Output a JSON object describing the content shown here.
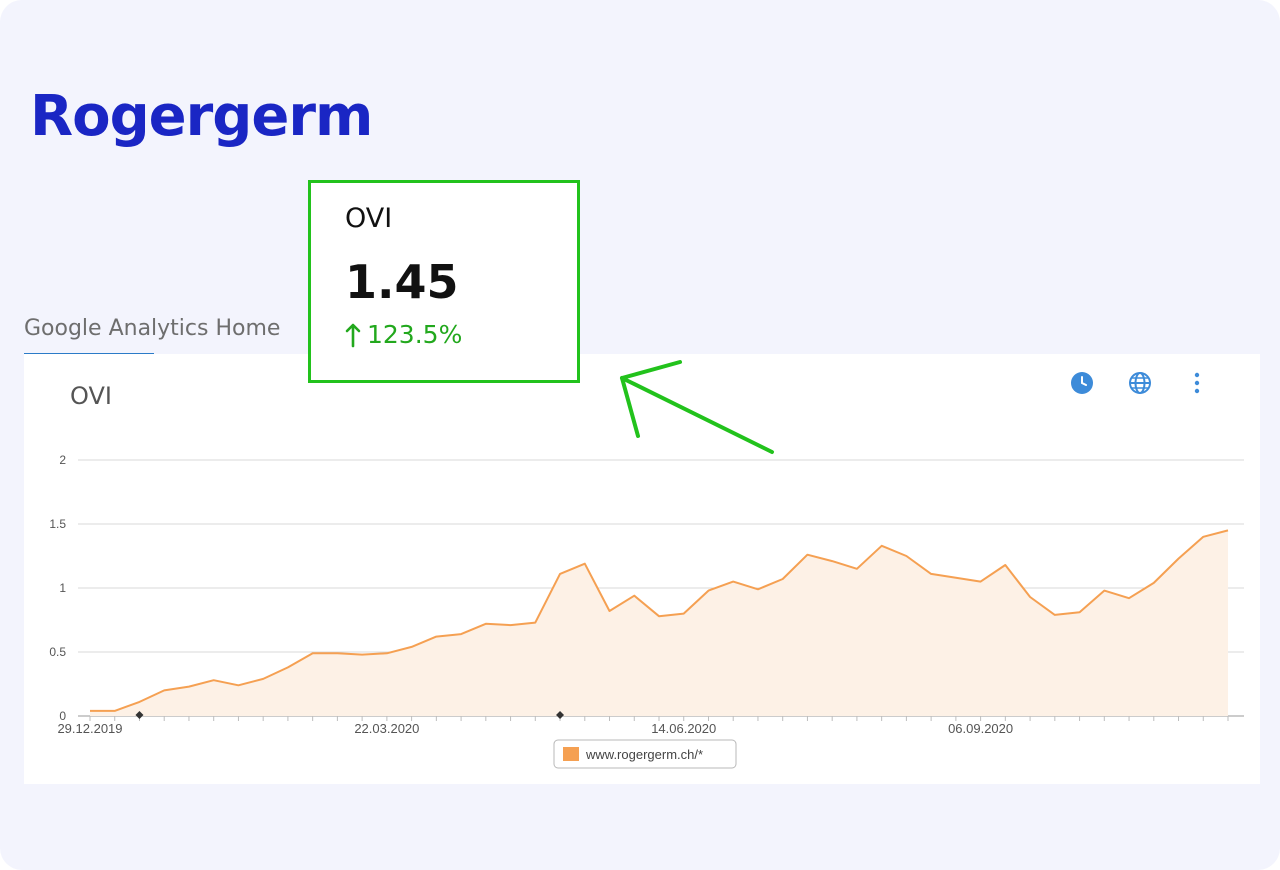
{
  "brand": {
    "title": "Rogergerm"
  },
  "tab": {
    "label": "Google Analytics Home"
  },
  "panel": {
    "title": "OVI",
    "icons": [
      "clock-icon",
      "globe-icon",
      "more-vertical-icon"
    ]
  },
  "kpi": {
    "label": "OVI",
    "value": "1.45",
    "change": "123.5%",
    "direction": "up"
  },
  "colors": {
    "brand": "#1a26c4",
    "series": "#f5a052",
    "area_fill": "#fdf1e6",
    "highlight": "#22c21c",
    "panel_icons": "#3d8bd9"
  },
  "chart_data": {
    "type": "area",
    "ylim": [
      0,
      2
    ],
    "yticks": [
      "0",
      "0.5",
      "1",
      "1.5",
      "2"
    ],
    "xtick_labels": [
      "29.12.2019",
      "22.03.2020",
      "14.06.2020",
      "06.09.2020"
    ],
    "series": [
      {
        "name": "www.rogergerm.ch/*",
        "values": [
          0.04,
          0.04,
          0.11,
          0.2,
          0.23,
          0.28,
          0.24,
          0.29,
          0.38,
          0.49,
          0.49,
          0.48,
          0.49,
          0.54,
          0.62,
          0.64,
          0.72,
          0.71,
          0.73,
          1.11,
          1.19,
          0.82,
          0.94,
          0.78,
          0.8,
          0.98,
          1.05,
          0.99,
          1.07,
          1.26,
          1.21,
          1.15,
          1.33,
          1.25,
          1.11,
          1.08,
          1.05,
          1.18,
          0.93,
          0.79,
          0.81,
          0.98,
          0.92,
          1.04,
          1.23,
          1.4,
          1.45
        ]
      }
    ],
    "grid": true,
    "legend_position": "bottom-center"
  }
}
